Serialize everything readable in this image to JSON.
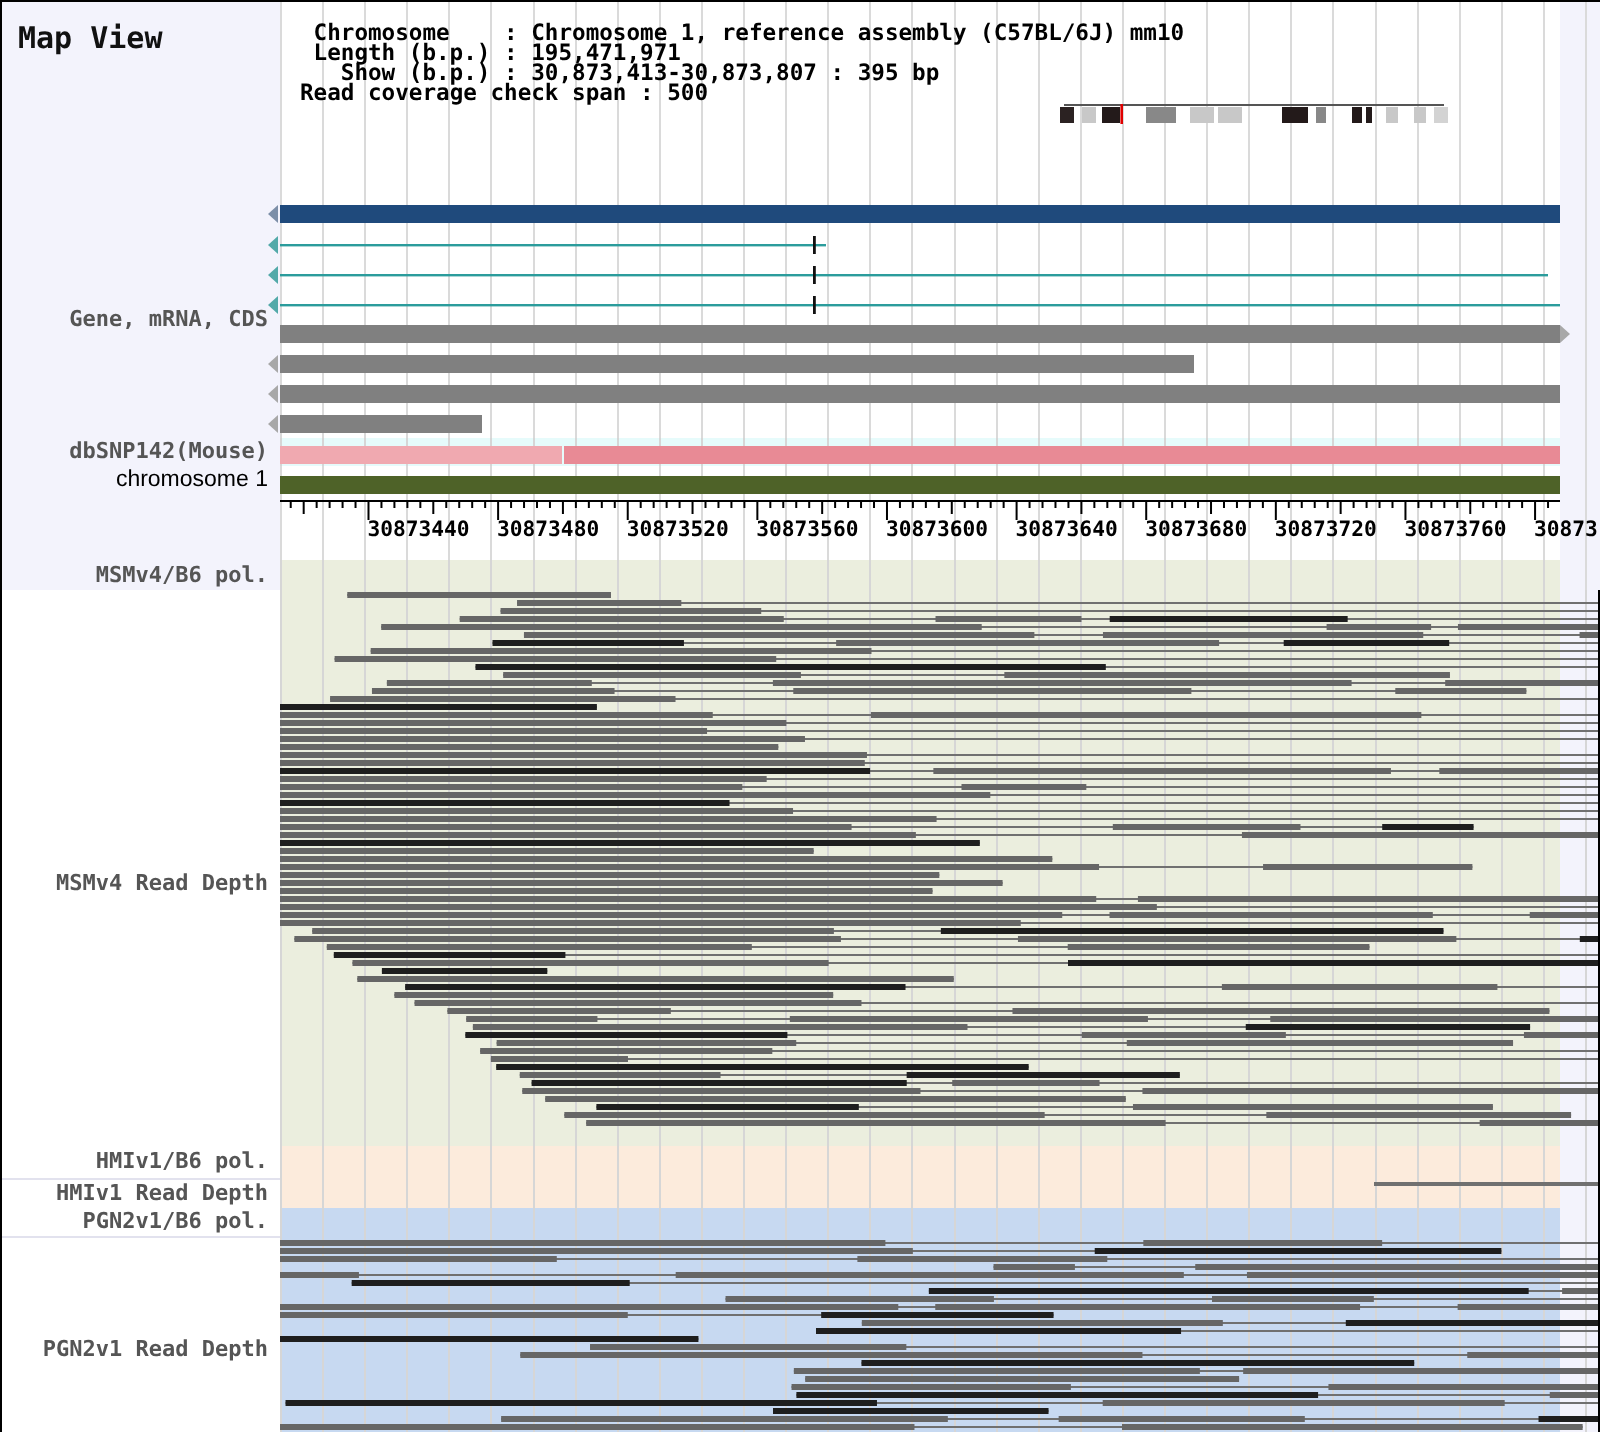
{
  "title": "Map View",
  "summary": {
    "lines": [
      " Chromosome    : Chromosome 1, reference assembly (C57BL/6J) mm10",
      " Length (b.p.) : 195,471,971",
      "   Show (b.p.) : 30,873,413-30,873,807 : 395 bp",
      "Read coverage check span : 500"
    ]
  },
  "tracks": [
    {
      "label": "Gene, mRNA, CDS",
      "kind": "gene"
    },
    {
      "label": "dbSNP142(Mouse)",
      "kind": "snp"
    },
    {
      "label": "chromosome 1",
      "kind": "chromosome"
    }
  ],
  "ruler": {
    "labels": [
      "30873440",
      "30873480",
      "30873520",
      "30873560",
      "30873600",
      "30873640",
      "30873680",
      "30873720",
      "30873760",
      "30873"
    ]
  },
  "read_tracks": [
    {
      "label": "MSMv4/B6 pol.",
      "kind": "polymorphism"
    },
    {
      "label": "MSMv4 Read Depth",
      "kind": "read_depth"
    },
    {
      "label": "HMIv1/B6 pol.",
      "kind": "polymorphism"
    },
    {
      "label": "HMIv1 Read Depth",
      "kind": "read_depth"
    },
    {
      "label": "PGN2v1/B6 pol.",
      "kind": "polymorphism"
    },
    {
      "label": "PGN2v1 Read Depth",
      "kind": "read_depth"
    }
  ]
}
